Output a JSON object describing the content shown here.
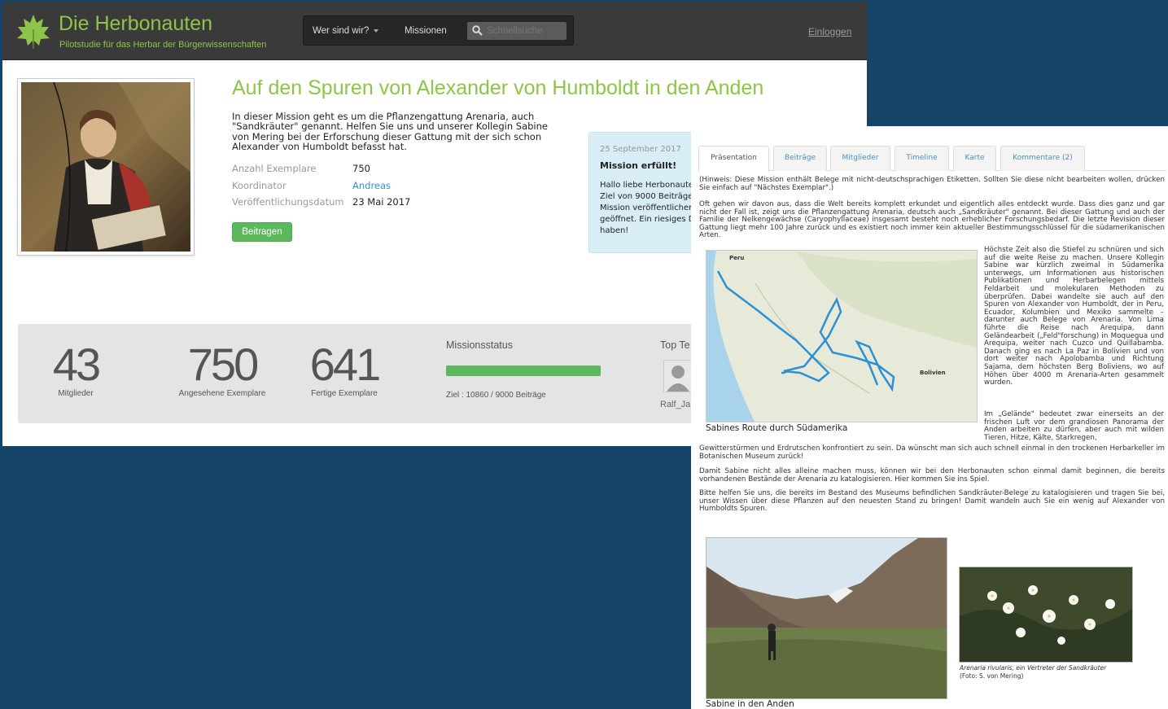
{
  "header": {
    "brand_title": "Die Herbonauten",
    "brand_subtitle": "Pilotstudie für das Herbar der Bürgerwissenschaften",
    "nav_about": "Wer sind wir?",
    "nav_missions": "Missionen",
    "search_placeholder": "Schnellsuche",
    "login": "Einloggen"
  },
  "mission": {
    "title": "Auf den Spuren von Alexander von Humboldt in den Anden",
    "description": "In dieser Mission geht es um die Pflanzengattung Arenaria, auch \"Sandkräuter\" genannt. Helfen Sie uns und unserer Kollegin Sabine von Mering bei der Erforschung dieser Gattung mit der sich schon Alexander von Humboldt befasst hat.",
    "meta": [
      {
        "key": "Anzahl Exemplare",
        "value": "750"
      },
      {
        "key": "Koordinator",
        "value": "Andreas"
      },
      {
        "key": "Veröffentlichungsdatum",
        "value": "23 Mai 2017"
      }
    ],
    "contribute_button": "Beitragen"
  },
  "notice": {
    "date": "25 September 2017",
    "heading": "Mission erfüllt!",
    "body": [
      "Hallo liebe Herbonaute",
      "Ziel von 9000 Beiträge",
      "Mission veröffentlicher",
      "geöffnet. Ein riesiges D",
      "haben!"
    ]
  },
  "stats": {
    "members": {
      "value": "43",
      "label": "Mitglieder"
    },
    "viewed": {
      "value": "750",
      "label": "Angesehene Exemplare"
    },
    "finished": {
      "value": "641",
      "label": "Fertige Exemplare"
    },
    "status_label": "Missionsstatus",
    "progress_fraction": 1.0,
    "status_text": "Ziel : 10860 / 9000 Beiträge",
    "top_team_label": "Top Te",
    "top_user": "Ralf_Ja"
  },
  "overlay": {
    "tabs": [
      "Präsentation",
      "Beiträge",
      "Mitglieder",
      "Timeline",
      "Karte",
      "Kommentare (2)"
    ],
    "hint": "(Hinweis: Diese Mission enthält Belege mit nicht-deutschsprachigen Etiketten. Sollten Sie diese nicht bearbeiten wollen, drücken Sie einfach auf \"Nächstes Exemplar\".)",
    "para1": "Oft gehen wir davon aus, dass die Welt bereits komplett erkundet und eigentlich alles entdeckt wurde. Dass dies ganz und gar nicht der Fall ist, zeigt uns die Pflanzengattung Arenaria, deutsch auch „Sandkräuter\" genannt. Bei dieser Gattung und auch der Familie der Nelkengewächse (Caryophyllaceae) insgesamt besteht noch erheblicher Forschungsbedarf. Die letzte Revision dieser Gattung liegt mehr 100 Jahre zurück und es existiert noch immer kein aktueller Bestimmungsschlüssel für die südamerikanischen Arten.",
    "para2": "Höchste Zeit also die Stiefel zu schnüren und sich auf die weite Reise zu machen. Unsere Kollegin Sabine war kürzlich zweimal in Südamerika unterwegs, um Informationen aus historischen Publikationen und Herbarbelegen mittels Feldarbeit und molekularen Methoden zu überprüfen. Dabei wandelte sie auch auf den Spuren von Alexander von Humboldt, der in Peru, Ecuador, Kolumbien und Mexiko sammelte – darunter auch Belege von Arenaria. Von Lima führte die Reise nach Arequipa, dann Geländearbeit („Feld\"forschung) in Moquegua und Arequipa, weiter nach Cuzco und Quillabamba. Danach ging es nach La Paz in Bolivien und von dort weiter nach Apolobamba und Richtung Sajama, dem höchsten Berg Boliviens, wo auf Höhen über 4000 m Arenaria-Arten gesammelt wurden.",
    "para3a": "Im „Gelände\" bedeutet zwar einerseits an der frischen Luft vor dem grandiosen Panorama der Anden arbeiten zu dürfen, aber auch mit wilden Tieren, Hitze, Kälte, Starkregen,",
    "para3b": "Gewitterstürmen und Erdrutschen konfrontiert zu sein. Da wünscht man sich auch schnell einmal in den trockenen Herbarkeller im Botanischen Museum zurück!",
    "para4": "Damit Sabine nicht alles alleine machen muss, können wir bei den Herbonauten schon einmal damit beginnen, die bereits vorhandenen Bestände der Arenaria zu katalogisieren. Hier kommen Sie ins Spiel.",
    "para5": "Bitte helfen Sie uns, die bereits im Bestand des Museums befindlichen Sandkräuter-Belege zu katalogisieren und tragen Sie bei, unser Wissen über diese Pflanzen auf den neuesten Stand zu bringen! Damit wandeln auch Sie ein wenig auf Alexander von Humboldts Spuren.",
    "map_label_peru": "Peru",
    "map_label_bolivia": "Bolivien",
    "map_caption": "Sabines Route durch Südamerika",
    "photo_caption": "Sabine in den Anden",
    "flower_caption_1": "Arenaria rivularis, ein Vertreter der Sandkräuter",
    "flower_caption_2": "(Foto: S. von Mering)"
  },
  "colors": {
    "brand_green": "#8fc44a",
    "navbar": "#3a3a3a",
    "success": "#5cb85c",
    "link": "#3a8fc9",
    "background": "#154466"
  }
}
